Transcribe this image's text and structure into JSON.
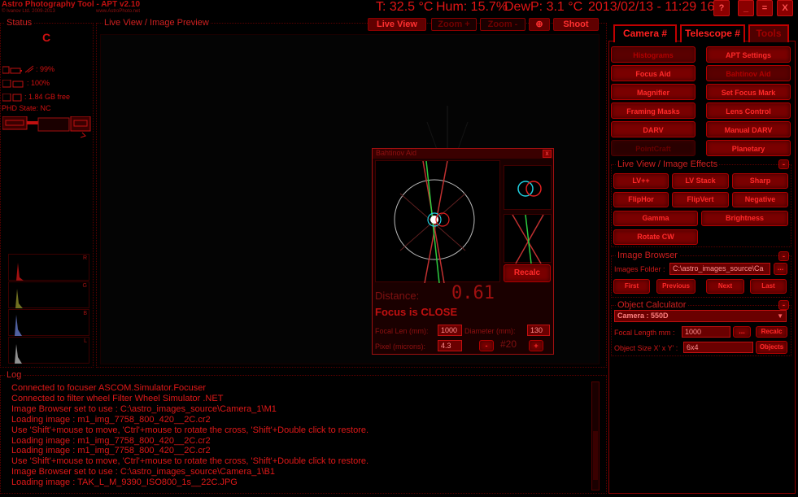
{
  "titlebar": {
    "app_title": "Astro Photography Tool - APT v2.10",
    "copyright": "© Ivanov Ltd. 2009-2013",
    "website": "www.AstroPhoto.net",
    "temperature": "T: 32.5 °C",
    "humidity": "Hum: 15.7%",
    "dewpoint": "DewP: 3.1 °C",
    "datetime": "2013/02/13 - 11:29 16",
    "help": "?",
    "minimize": "_",
    "maximize": "=",
    "close": "X"
  },
  "status": {
    "title": "Status",
    "letter": "C",
    "battery": ": 99%",
    "storage": ": 100%",
    "disk": ": 1.84 GB free",
    "phd_state": "PHD State: NC"
  },
  "liveview": {
    "title": "Live View / Image Preview",
    "live_view": "Live View",
    "zoom_plus": "Zoom +",
    "zoom_minus": "Zoom -",
    "crosshair": "⊕",
    "shoot": "Shoot"
  },
  "histogram": {
    "channels": [
      "R",
      "G",
      "B",
      "L"
    ]
  },
  "bahtinov": {
    "title": "Bahtinov Aid",
    "close": "x",
    "recalc": "Recalc",
    "distance_label": "Distance:",
    "distance_value": "0.61",
    "status": "Focus is CLOSE",
    "focal_len_label": "Focal Len (mm):",
    "focal_len_value": "1000",
    "diameter_label": "Diameter (mm):",
    "diameter_value": "130",
    "pixel_label": "Pixel (microns):",
    "pixel_value": "4.3",
    "minus": "-",
    "count": "#20",
    "plus": "+"
  },
  "log": {
    "title": "Log",
    "lines": [
      "Connected to focuser ASCOM.Simulator.Focuser",
      "Connected to filter wheel Filter Wheel Simulator .NET",
      "Image Browser set to use : C:\\astro_images_source\\Camera_1\\M1",
      "Loading image : m1_img_7758_800_420__2C.cr2",
      "Use 'Shift'+mouse to move, 'Ctrl'+mouse to rotate the cross, 'Shift'+Double click to restore.",
      "Loading image : m1_img_7758_800_420__2C.cr2",
      "Loading image : m1_img_7758_800_420__2C.cr2",
      "Use 'Shift'+mouse to move, 'Ctrl'+mouse to rotate the cross, 'Shift'+Double click to restore.",
      "Image Browser set to use : C:\\astro_images_source\\Camera_1\\B1",
      "Loading image : TAK_L_M_9390_ISO800_1s__22C.JPG"
    ]
  },
  "tabs": {
    "camera": "Camera #",
    "telescope": "Telescope #",
    "tools": "Tools"
  },
  "tools": {
    "histograms": "Histograms",
    "apt_settings": "APT Settings",
    "focus_aid": "Focus Aid",
    "bahtinov_aid": "Bahtinov Aid",
    "magnifier": "Magnifier",
    "set_focus_mark": "Set Focus Mark",
    "framing_masks": "Framing Masks",
    "lens_control": "Lens Control",
    "darv": "DARV",
    "manual_darv": "Manual DARV",
    "pointcraft": "PointCraft",
    "planetary": "Planetary"
  },
  "effects": {
    "title": "Live View / Image Effects",
    "collapse": "-",
    "lvpp": "LV++",
    "lv_stack": "LV Stack",
    "sharp": "Sharp",
    "fliphor": "FlipHor",
    "flipvert": "FlipVert",
    "negative": "Negative",
    "gamma": "Gamma",
    "brightness": "Brightness",
    "rotate_cw": "Rotate CW"
  },
  "browser": {
    "title": "Image Browser",
    "collapse": "-",
    "folder_label": "Images Folder :",
    "folder_value": "C:\\astro_images_source\\Ca",
    "browse": "...",
    "first": "First",
    "previous": "Previous",
    "next": "Next",
    "last": "Last"
  },
  "calculator": {
    "title": "Object Calculator",
    "collapse": "-",
    "camera_select": "Camera : 550D",
    "focal_label": "Focal Length mm :",
    "focal_value": "1000",
    "browse": "...",
    "recalc": "Recalc",
    "size_label": "Object Size X' x Y' :",
    "size_value": "6x4",
    "objects": "Objects"
  },
  "colors": {
    "accent": "#d01010",
    "button": "#7a0000",
    "green_line": "#2ecc40",
    "cyan_circle": "#20d0e0"
  }
}
